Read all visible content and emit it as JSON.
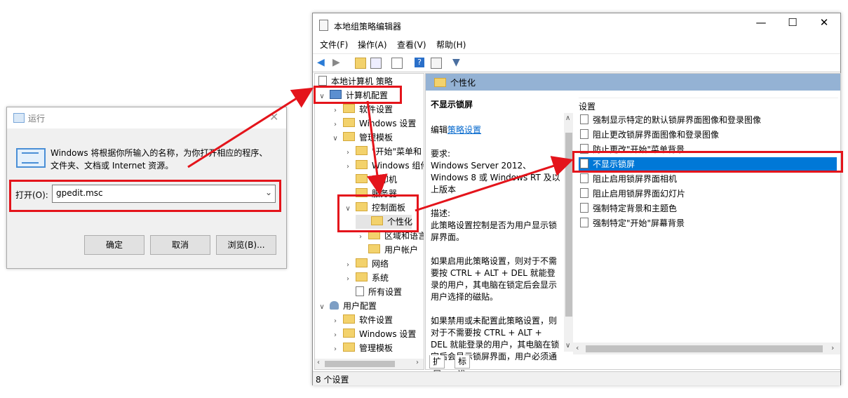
{
  "run_dialog": {
    "title": "运行",
    "description": "Windows 将根据你所输入的名称，为你打开相应的程序、文件夹、文档或 Internet 资源。",
    "open_label": "打开(O):",
    "command_value": "gpedit.msc",
    "ok_label": "确定",
    "cancel_label": "取消",
    "browse_label": "浏览(B)..."
  },
  "gpedit": {
    "title": "本地组策略编辑器",
    "menu": [
      "文件(F)",
      "操作(A)",
      "查看(V)",
      "帮助(H)"
    ],
    "tree": {
      "root": "本地计算机 策略",
      "computer_config": "计算机配置",
      "software_settings": "软件设置",
      "windows_settings": "Windows 设置",
      "admin_templates": "管理模板",
      "start_menu": "\"开始\"菜单和",
      "windows_components": "Windows 组件",
      "printers": "打印机",
      "servers": "服务器",
      "control_panel": "控制面板",
      "personalization": "个性化",
      "regional": "区域和语言",
      "user_accounts": "用户帐户",
      "network": "网络",
      "system": "系统",
      "all_settings": "所有设置",
      "user_config": "用户配置",
      "user_software_settings": "软件设置",
      "user_windows_settings": "Windows 设置",
      "user_admin_templates": "管理模板"
    },
    "right_header": "个性化",
    "description_pane": {
      "heading": "不显示锁屏",
      "edit_prefix": "编辑",
      "edit_link": "策略设置",
      "requirements_label": "要求:",
      "requirements": "Windows Server 2012、Windows 8 或 Windows RT 及以上版本",
      "desc_label": "描述:",
      "desc_1": "此策略设置控制是否为用户显示锁屏界面。",
      "desc_2": "如果启用此策略设置，则对于不需要按 CTRL + ALT + DEL 就能登录的用户，其电脑在锁定后会显示用户选择的磁贴。",
      "desc_3": "如果禁用或未配置此策略设置，则对于不需要按 CTRL + ALT + DEL 就能登录的用户，其电脑在锁定后会显示锁屏界面，用户必须通"
    },
    "list_header": "设置",
    "settings": [
      "强制显示特定的默认锁屏界面图像和登录图像",
      "阻止更改锁屏界面图像和登录图像",
      "防止更改\"开始\"菜单背景",
      "不显示锁屏",
      "阻止启用锁屏界面相机",
      "阻止启用锁屏界面幻灯片",
      "强制特定背景和主题色",
      "强制特定\"开始\"屏幕背景"
    ],
    "selected_setting_index": 3,
    "tabs": [
      "扩展",
      "标准"
    ],
    "status": "8 个设置"
  },
  "colors": {
    "annotation_red": "#e4141b",
    "selection_blue": "#0078d7",
    "header_blue": "#94b2d4"
  }
}
